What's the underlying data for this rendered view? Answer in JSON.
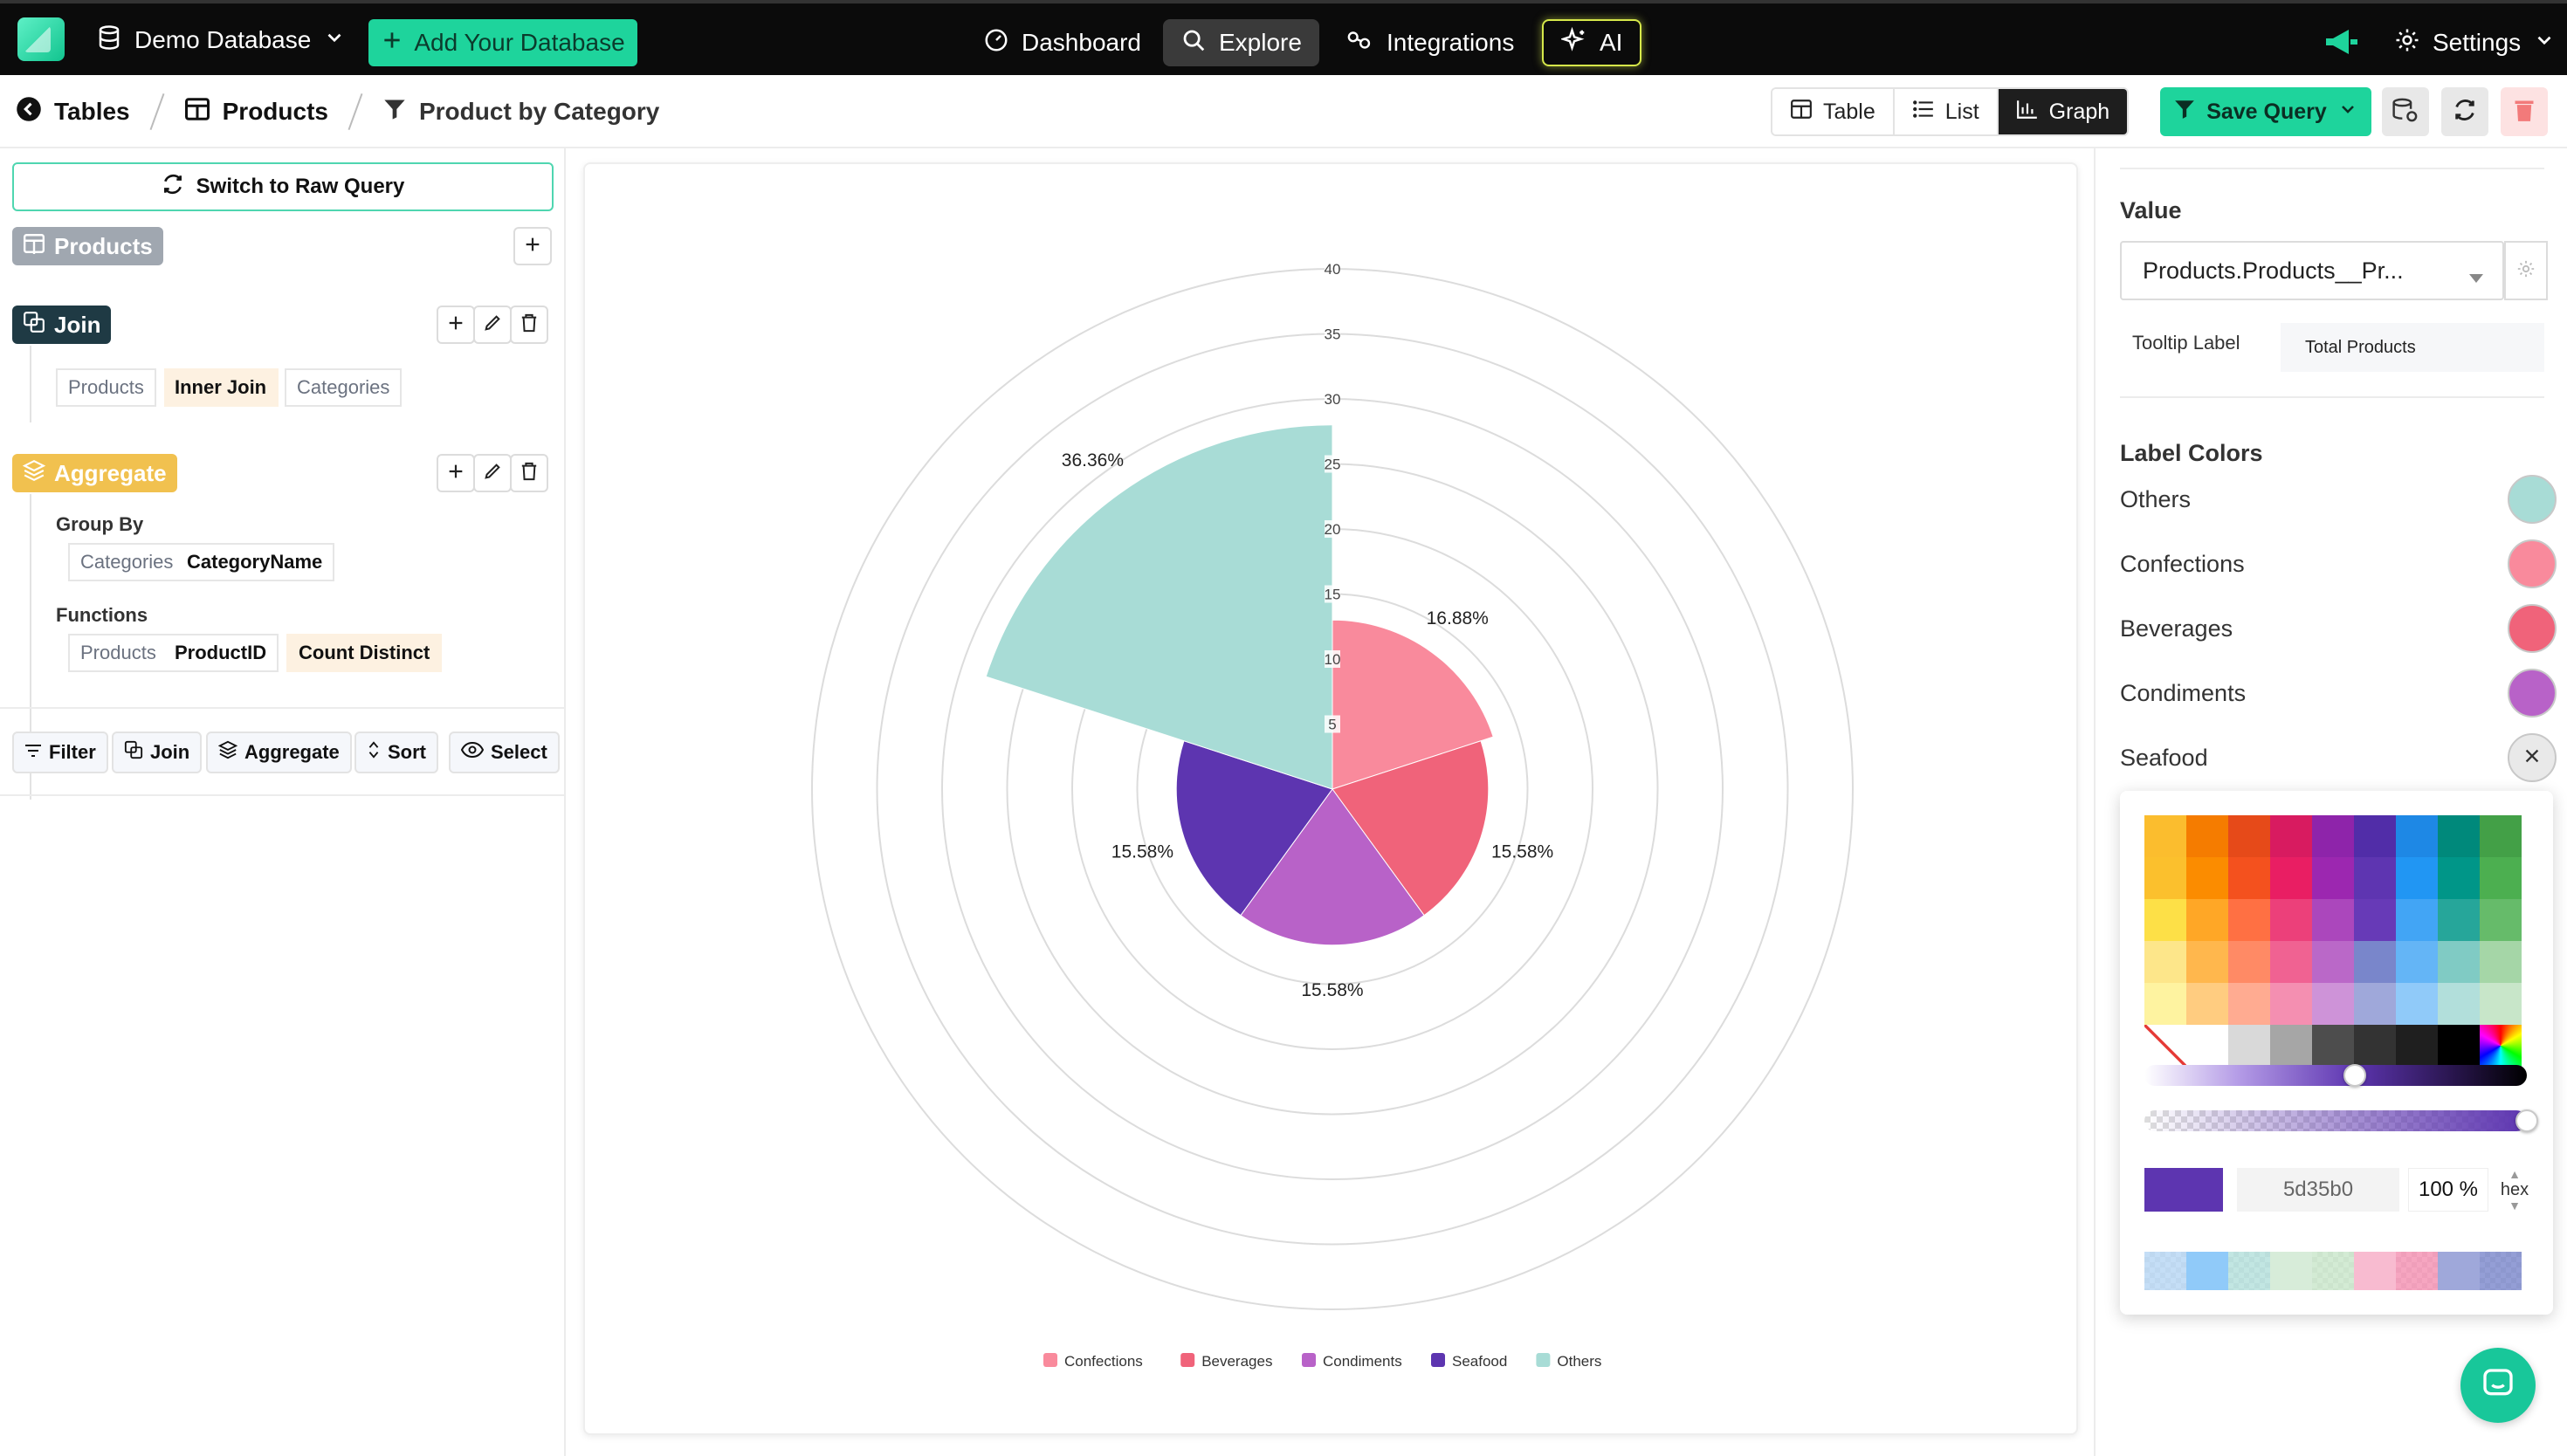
{
  "topbar": {
    "database_label": "Demo Database",
    "add_database_label": "Add Your Database",
    "nav": [
      {
        "label": "Dashboard"
      },
      {
        "label": "Explore"
      },
      {
        "label": "Integrations"
      },
      {
        "label": "AI"
      }
    ],
    "settings_label": "Settings"
  },
  "breadcrumb": {
    "tables": "Tables",
    "table": "Products",
    "query": "Product by Category"
  },
  "view_toggle": {
    "table": "Table",
    "list": "List",
    "graph": "Graph",
    "active": "Graph"
  },
  "toolbar": {
    "save_label": "Save Query"
  },
  "builder": {
    "raw_query_label": "Switch to Raw Query",
    "source_table": "Products",
    "join": {
      "label": "Join",
      "left": "Products",
      "type": "Inner Join",
      "right": "Categories"
    },
    "aggregate": {
      "label": "Aggregate",
      "group_by_label": "Group By",
      "group_by_table": "Categories",
      "group_by_field": "CategoryName",
      "functions_label": "Functions",
      "function_table": "Products",
      "function_field": "ProductID",
      "function_op": "Count Distinct"
    },
    "actions": [
      {
        "label": "Filter"
      },
      {
        "label": "Join"
      },
      {
        "label": "Aggregate"
      },
      {
        "label": "Sort"
      },
      {
        "label": "Select"
      }
    ]
  },
  "settings": {
    "value_title": "Value",
    "value_selected": "Products.Products__Pr...",
    "tooltip_label": "Tooltip Label",
    "tooltip_value": "Total Products",
    "label_colors_title": "Label Colors",
    "label_colors": [
      {
        "name": "Others",
        "color": "#a8dcd6"
      },
      {
        "name": "Confections",
        "color": "#f98a9c"
      },
      {
        "name": "Beverages",
        "color": "#f0637a"
      },
      {
        "name": "Condiments",
        "color": "#b862c8"
      },
      {
        "name": "Seafood",
        "color": "#5d35b0"
      }
    ],
    "picker": {
      "hex": "5d35b0",
      "alpha": "100 %",
      "mode": "hex",
      "hue_position": 0.55,
      "alpha_position": 1.0
    }
  },
  "chart_data": {
    "type": "polar-area",
    "radial_ticks": [
      5,
      10,
      15,
      20,
      25,
      30,
      35,
      40
    ],
    "radial_max": 40,
    "series": [
      {
        "label": "Confections",
        "value": 13,
        "percent": "16.88%",
        "color": "#f98a9c"
      },
      {
        "label": "Beverages",
        "value": 12,
        "percent": "15.58%",
        "color": "#f0637a"
      },
      {
        "label": "Condiments",
        "value": 12,
        "percent": "15.58%",
        "color": "#b862c8"
      },
      {
        "label": "Seafood",
        "value": 12,
        "percent": "15.58%",
        "color": "#5d35b0"
      },
      {
        "label": "Others",
        "value": 28,
        "percent": "36.36%",
        "color": "#a8dcd6"
      }
    ],
    "legend": [
      "Confections",
      "Beverages",
      "Condiments",
      "Seafood",
      "Others"
    ]
  }
}
